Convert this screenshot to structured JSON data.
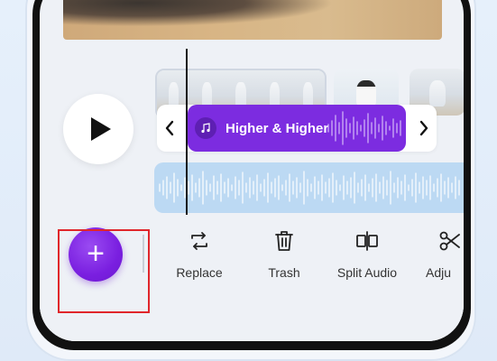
{
  "audio_clip": {
    "title": "Higher & Higher"
  },
  "toolbar": {
    "items": [
      {
        "label": "Replace",
        "icon": "replace-icon"
      },
      {
        "label": "Trash",
        "icon": "trash-icon"
      },
      {
        "label": "Split Audio",
        "icon": "split-audio-icon"
      },
      {
        "label": "Adju",
        "icon": "scissors-icon"
      }
    ],
    "add_button": {
      "icon": "plus-icon",
      "symbol": "+"
    }
  },
  "colors": {
    "accent": "#7c2ce0",
    "waveform": "#bcd9f3",
    "highlight": "#e0262b"
  }
}
